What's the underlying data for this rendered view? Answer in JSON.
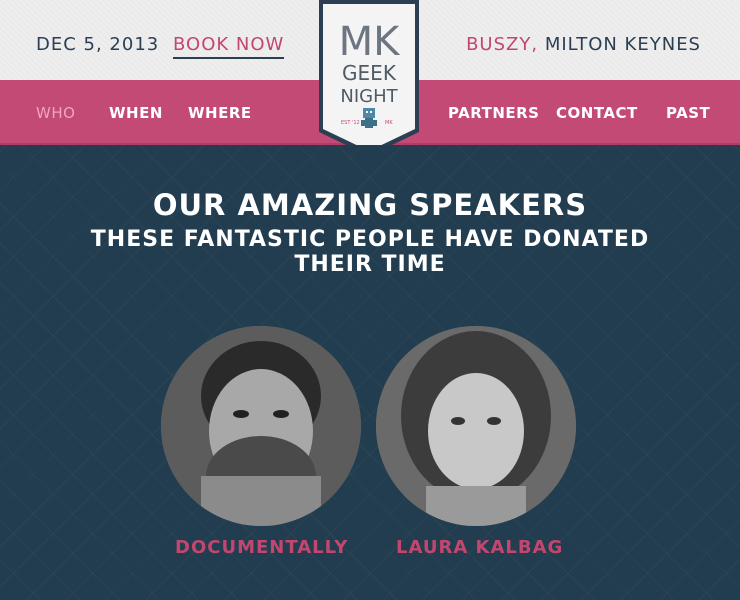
{
  "header": {
    "date": "DEC 5, 2013",
    "book_label": "BOOK NOW",
    "venue_name": "BUSZY,",
    "venue_city": "MILTON KEYNES"
  },
  "logo": {
    "line1": "MK",
    "line2": "GEEK",
    "line3": "NIGHT",
    "est": "EST '12",
    "city": "MK"
  },
  "nav": {
    "left": [
      "WHO",
      "WHEN",
      "WHERE"
    ],
    "right": [
      "PARTNERS",
      "CONTACT",
      "PAST"
    ],
    "active": "WHO"
  },
  "speakers_section": {
    "title": "OUR AMAZING SPEAKERS",
    "subtitle": "THESE FANTASTIC PEOPLE HAVE DONATED THEIR TIME",
    "speakers": [
      {
        "name": "DOCUMENTALLY"
      },
      {
        "name": "LAURA KALBAG"
      }
    ]
  },
  "colors": {
    "pink": "#c24a75",
    "navy": "#223d4f",
    "text_dark": "#2c3f52"
  }
}
